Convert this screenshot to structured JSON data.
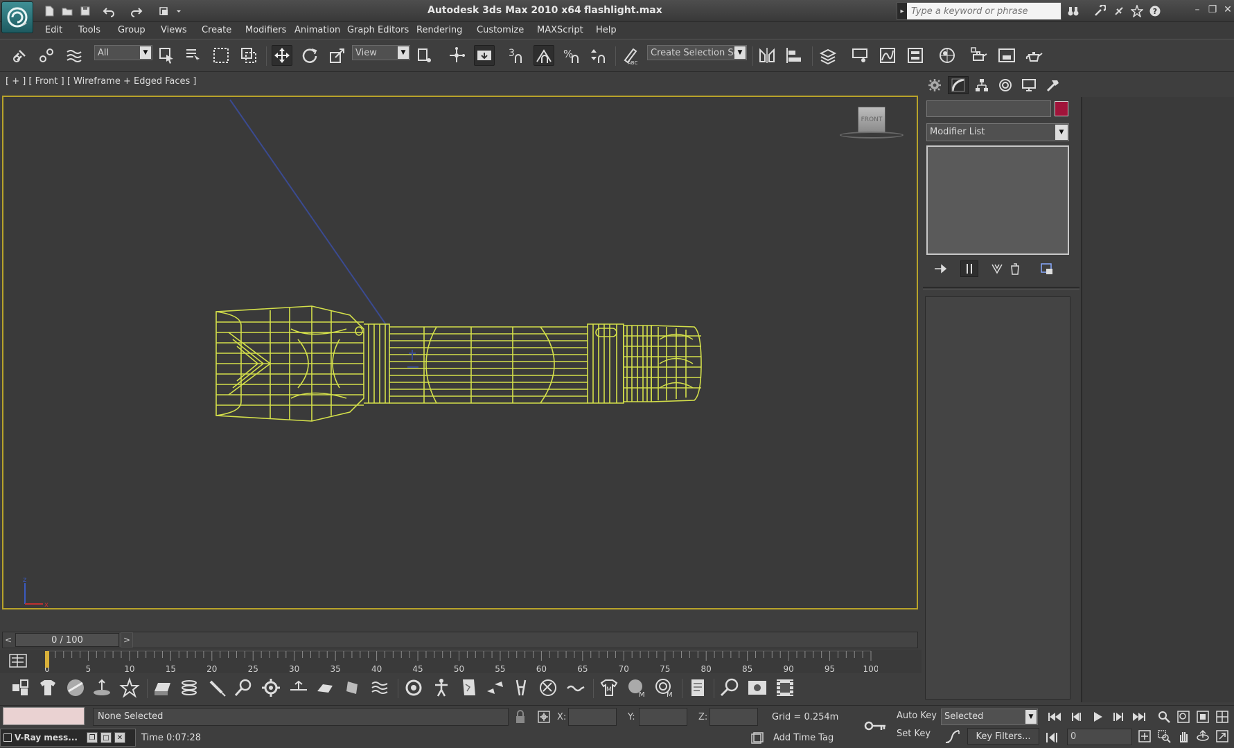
{
  "window": {
    "title": "Autodesk 3ds Max  2010 x64",
    "file": "flashlight.max",
    "search_placeholder": "Type a keyword or phrase"
  },
  "menu": [
    "Edit",
    "Tools",
    "Group",
    "Views",
    "Create",
    "Modifiers",
    "Animation",
    "Graph Editors",
    "Rendering",
    "Customize",
    "MAXScript",
    "Help"
  ],
  "toolbar": {
    "selection_filter": "All",
    "ref_coord": "View",
    "named_selection": "Create Selection Se",
    "snap_label": "3"
  },
  "viewport": {
    "label": "[ + ] [ Front ] [ Wireframe + Edged Faces ]",
    "viewcube_face": "FRONT",
    "axis_z": "z",
    "axis_x": "x",
    "wire_color": "#d4e04a",
    "border_color": "#b8a32a"
  },
  "command_panel": {
    "modifier_list": "Modifier List",
    "object_color": "#a0143a"
  },
  "timeline": {
    "frame_display": "0 / 100",
    "prev": "<",
    "next": ">",
    "ticks": [
      "0",
      "5",
      "10",
      "15",
      "20",
      "25",
      "30",
      "35",
      "40",
      "45",
      "50",
      "55",
      "60",
      "65",
      "70",
      "75",
      "80",
      "85",
      "90",
      "95",
      "100"
    ]
  },
  "status": {
    "selection": "None Selected",
    "vray_window": "V-Ray mess...",
    "time": "Time  0:07:28",
    "x_label": "X:",
    "y_label": "Y:",
    "z_label": "Z:",
    "grid": "Grid = 0.254m",
    "add_time_tag": "Add Time Tag",
    "auto_key": "Auto Key",
    "set_key": "Set Key",
    "key_mode": "Selected",
    "key_filters": "Key Filters...",
    "frame": "0"
  }
}
